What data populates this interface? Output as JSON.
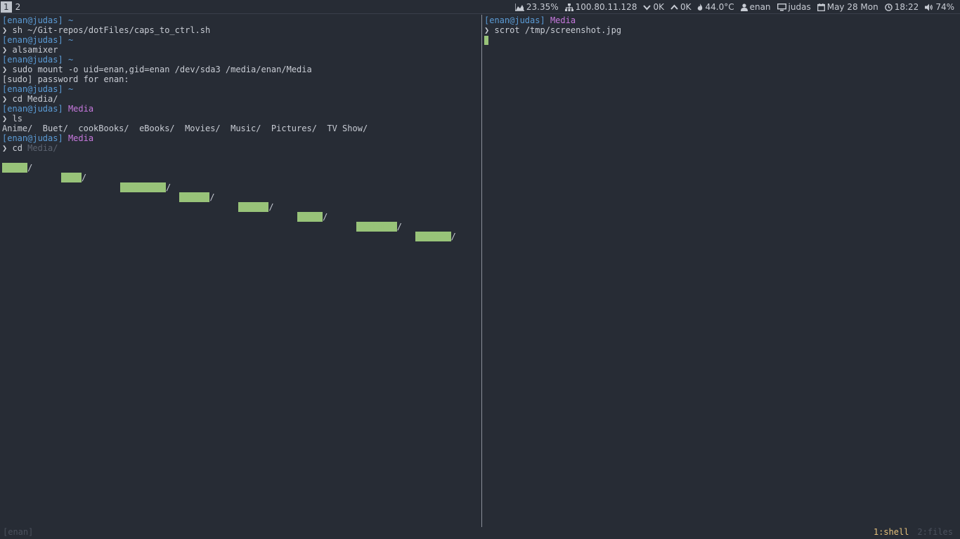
{
  "workspaces": [
    {
      "label": "1",
      "active": true
    },
    {
      "label": "2",
      "active": false
    }
  ],
  "status": {
    "cpu": "23.35%",
    "ip": "100.80.11.128",
    "down": "0K",
    "up": "0K",
    "temp": "44.0°C",
    "user": "enan",
    "host": "judas",
    "date": "May 28 Mon",
    "time": "18:22",
    "volume": "74%"
  },
  "left_pane": {
    "prompt_user": "[enan@judas]",
    "lines": {
      "l1_dir": "~",
      "l2_cmd": "sh ~/Git-repos/dotFiles/caps_to_ctrl.sh",
      "l3_dir": "~",
      "l4_cmd": "alsamixer",
      "l5_dir": "~",
      "l6_cmd": "sudo mount -o uid=enan,gid=enan /dev/sda3 /media/enan/Media",
      "l7_out": "[sudo] password for enan:",
      "l8_dir": "~",
      "l9_cmd": "cd Media/",
      "l10_dir": "Media",
      "l11_cmd": "ls",
      "l12_out": "Anime/  Buet/  cookBooks/  eBooks/  Movies/  Music/  Pictures/  TV Show/",
      "l13_dir": "Media",
      "l14_cmd": "cd",
      "l14_ghost": "Media/"
    },
    "completions": [
      "Anime",
      "Buet",
      "cookBooks",
      "eBooks",
      "Movies",
      "Music",
      "Pictures",
      "TV Show"
    ]
  },
  "right_pane": {
    "prompt_user": "[enan@judas]",
    "dir": "Media",
    "cmd": "scrot /tmp/screenshot.jpg"
  },
  "prompt_arrow": "❯",
  "bottom": {
    "session": "[enan]",
    "window_active": "1:shell",
    "window_other": "2:files"
  },
  "colors": {
    "background": "#272c35",
    "user": "#5b9bd5",
    "dir": "#c678dd",
    "highlight": "#98c379",
    "active_window": "#e5c07b"
  }
}
